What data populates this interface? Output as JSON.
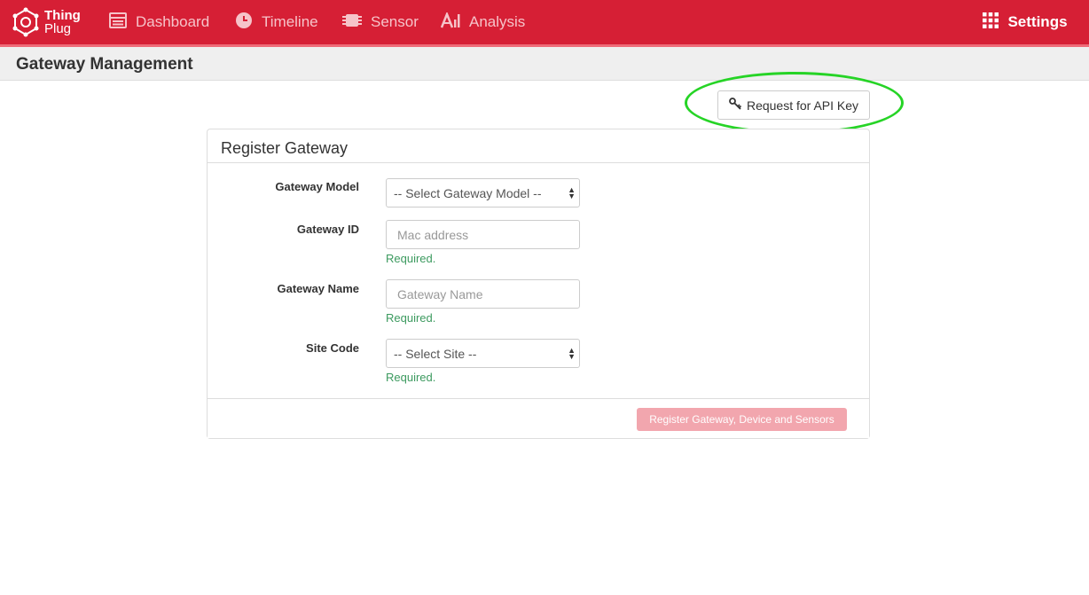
{
  "brand": {
    "line1": "Thing",
    "line2": "Plug"
  },
  "nav": {
    "dashboard": "Dashboard",
    "timeline": "Timeline",
    "sensor": "Sensor",
    "analysis": "Analysis",
    "settings": "Settings"
  },
  "page": {
    "title": "Gateway Management"
  },
  "api_button": {
    "label": "Request for API Key"
  },
  "panel": {
    "title": "Register Gateway",
    "fields": {
      "model": {
        "label": "Gateway Model",
        "value": "-- Select Gateway Model --"
      },
      "id": {
        "label": "Gateway ID",
        "placeholder": "Mac address",
        "help": "Required."
      },
      "name": {
        "label": "Gateway Name",
        "placeholder": "Gateway Name",
        "help": "Required."
      },
      "site": {
        "label": "Site Code",
        "value": "-- Select Site --",
        "help": "Required."
      }
    },
    "submit_label": "Register Gateway, Device and Sensors"
  },
  "colors": {
    "brand": "#d61f35",
    "highlight": "#26d426",
    "help_text": "#3c9a5f",
    "disabled_button": "#f2a6ae"
  },
  "icons": {
    "logo": "thingplug-logo-icon",
    "dashboard": "dashboard-icon",
    "timeline": "clock-icon",
    "sensor": "chip-icon",
    "analysis": "chart-icon",
    "settings": "grid-icon",
    "api": "key-icon"
  }
}
